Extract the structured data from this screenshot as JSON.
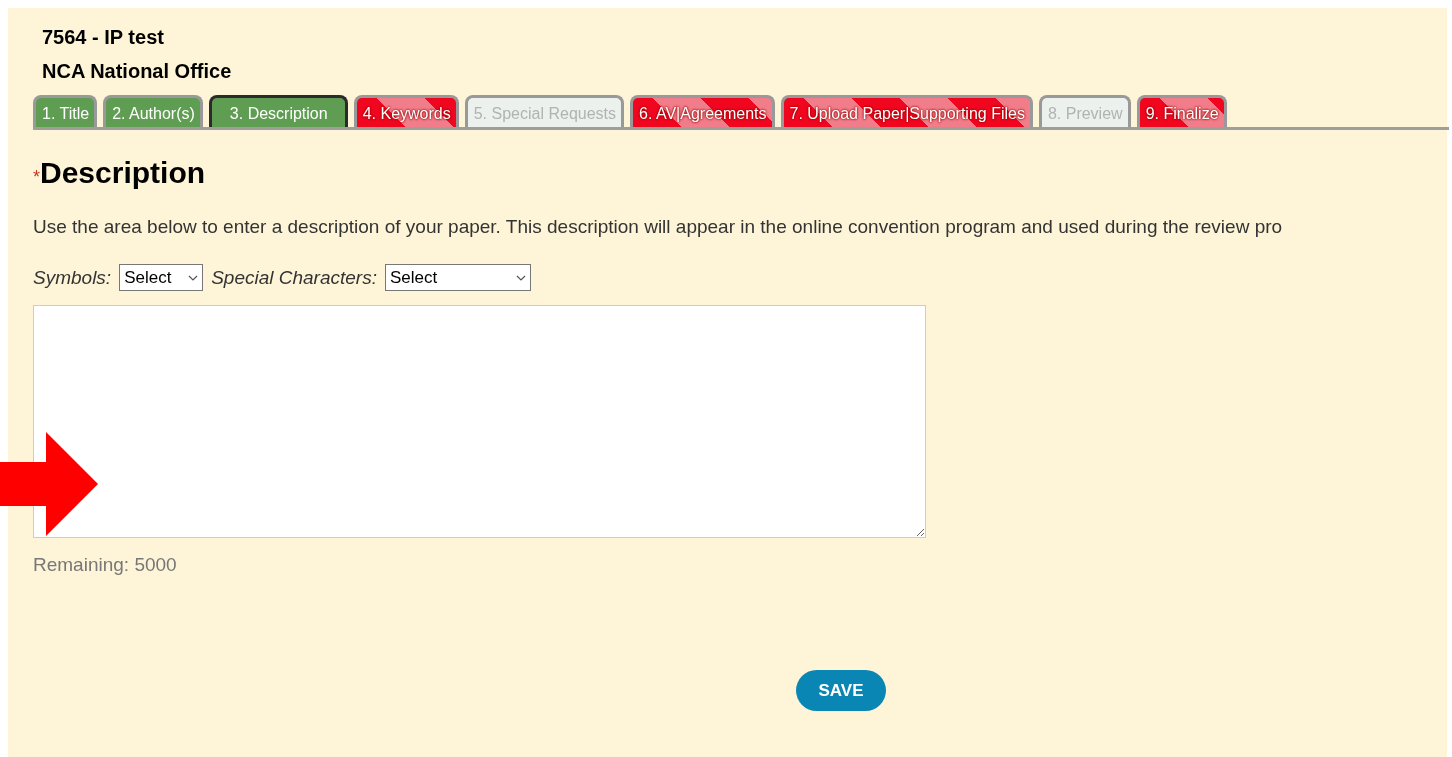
{
  "header": {
    "title": "7564 - IP test",
    "organization": "NCA National Office"
  },
  "tabs": [
    {
      "label": "1. Title",
      "kind": "complete",
      "selected": false
    },
    {
      "label": "2. Author(s)",
      "kind": "complete",
      "selected": false
    },
    {
      "label": "3. Description",
      "kind": "complete",
      "selected": true
    },
    {
      "label": "4. Keywords",
      "kind": "incomplete",
      "selected": false
    },
    {
      "label": "5. Special Requests",
      "kind": "disabled",
      "selected": false
    },
    {
      "label": "6. AV|Agreements",
      "kind": "incomplete",
      "selected": false
    },
    {
      "label": "7. Upload Paper|Supporting Files",
      "kind": "incomplete",
      "selected": false
    },
    {
      "label": "8. Preview",
      "kind": "disabled",
      "selected": false
    },
    {
      "label": "9. Finalize",
      "kind": "incomplete",
      "selected": false
    }
  ],
  "section": {
    "required_mark": "*",
    "heading": "Description",
    "instructions": "Use the area below to enter a description of your paper. This description will appear in the online convention program and used during the review pro"
  },
  "pickers": [
    {
      "label": "Symbols:",
      "value": "Select"
    },
    {
      "label": "Special Characters:",
      "value": "Select"
    }
  ],
  "remaining": "Remaining: 5000",
  "save_button": "SAVE"
}
